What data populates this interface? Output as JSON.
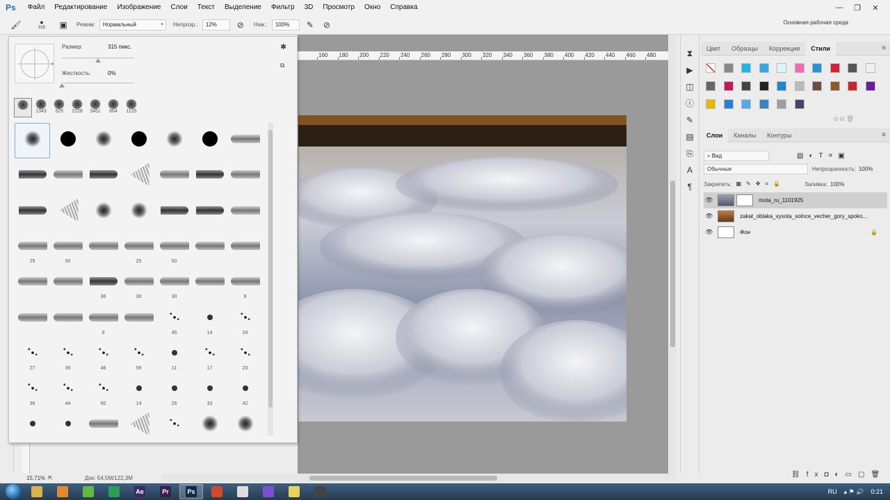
{
  "app": {
    "logo": "Ps"
  },
  "menu": [
    "Файл",
    "Редактирование",
    "Изображение",
    "Слои",
    "Текст",
    "Выделение",
    "Фильтр",
    "3D",
    "Просмотр",
    "Окно",
    "Справка"
  ],
  "window_controls": [
    "—",
    "❐",
    "✕"
  ],
  "options": {
    "brush_size_small": "315",
    "mode_label": "Режим:",
    "mode_value": "Нормальный",
    "opacity_label": "Непрозр.:",
    "opacity_value": "12%",
    "flow_label": "Наж.:",
    "flow_value": "100%",
    "workspace": "Основная рабочая среда"
  },
  "brush_panel": {
    "size_label": "Размер:",
    "size_value": "315 пикс.",
    "hardness_label": "Жесткость:",
    "hardness_value": "0%",
    "size_level": 0.5,
    "hardness_level": 0.0,
    "recent": [
      "",
      "1343",
      "329",
      "2228",
      "3461",
      "664",
      "1125"
    ],
    "brushes": [
      {
        "kind": "soft",
        "size": ""
      },
      {
        "kind": "hard",
        "size": ""
      },
      {
        "kind": "soft",
        "size": ""
      },
      {
        "kind": "hard",
        "size": ""
      },
      {
        "kind": "soft",
        "size": ""
      },
      {
        "kind": "hard",
        "size": ""
      },
      {
        "kind": "pencil",
        "size": ""
      },
      {
        "kind": "brushstroke",
        "size": ""
      },
      {
        "kind": "pencil",
        "size": ""
      },
      {
        "kind": "brushstroke",
        "size": ""
      },
      {
        "kind": "fan",
        "size": ""
      },
      {
        "kind": "pencil",
        "size": ""
      },
      {
        "kind": "brushstroke",
        "size": ""
      },
      {
        "kind": "pencil",
        "size": ""
      },
      {
        "kind": "brushstroke",
        "size": ""
      },
      {
        "kind": "fan",
        "size": ""
      },
      {
        "kind": "soft",
        "size": ""
      },
      {
        "kind": "soft",
        "size": ""
      },
      {
        "kind": "brushstroke",
        "size": ""
      },
      {
        "kind": "brushstroke",
        "size": ""
      },
      {
        "kind": "pencil",
        "size": ""
      },
      {
        "kind": "pencil",
        "size": "25"
      },
      {
        "kind": "pencil",
        "size": "50"
      },
      {
        "kind": "pencil",
        "size": ""
      },
      {
        "kind": "pencil",
        "size": "25"
      },
      {
        "kind": "pencil",
        "size": "50"
      },
      {
        "kind": "pencil",
        "size": ""
      },
      {
        "kind": "pencil",
        "size": ""
      },
      {
        "kind": "pencil",
        "size": ""
      },
      {
        "kind": "pencil",
        "size": ""
      },
      {
        "kind": "brushstroke",
        "size": "36"
      },
      {
        "kind": "pencil",
        "size": "30"
      },
      {
        "kind": "pencil",
        "size": "30"
      },
      {
        "kind": "pencil",
        "size": ""
      },
      {
        "kind": "pencil",
        "size": "9"
      },
      {
        "kind": "pencil",
        "size": ""
      },
      {
        "kind": "pencil",
        "size": ""
      },
      {
        "kind": "pencil",
        "size": "9"
      },
      {
        "kind": "pencil",
        "size": ""
      },
      {
        "kind": "spatter",
        "size": "45"
      },
      {
        "kind": "small-dot",
        "size": "14"
      },
      {
        "kind": "spatter",
        "size": "24"
      },
      {
        "kind": "spatter",
        "size": "27"
      },
      {
        "kind": "spatter",
        "size": "39"
      },
      {
        "kind": "spatter",
        "size": "46"
      },
      {
        "kind": "spatter",
        "size": "59"
      },
      {
        "kind": "small-dot",
        "size": "11"
      },
      {
        "kind": "spatter",
        "size": "17"
      },
      {
        "kind": "spatter",
        "size": "23"
      },
      {
        "kind": "spatter",
        "size": "36"
      },
      {
        "kind": "spatter",
        "size": "44"
      },
      {
        "kind": "spatter",
        "size": "60"
      },
      {
        "kind": "small-dot",
        "size": "14"
      },
      {
        "kind": "small-dot",
        "size": "26"
      },
      {
        "kind": "small-dot",
        "size": "33"
      },
      {
        "kind": "small-dot",
        "size": "42"
      },
      {
        "kind": "small-dot",
        "size": ""
      },
      {
        "kind": "small-dot",
        "size": ""
      },
      {
        "kind": "pencil",
        "size": ""
      },
      {
        "kind": "fan",
        "size": ""
      },
      {
        "kind": "spatter",
        "size": ""
      },
      {
        "kind": "soft",
        "size": ""
      },
      {
        "kind": "soft",
        "size": ""
      }
    ]
  },
  "ruler": [
    "160",
    "180",
    "200",
    "220",
    "240",
    "260",
    "280",
    "300",
    "320",
    "340",
    "360",
    "380",
    "400",
    "420",
    "440",
    "460",
    "480"
  ],
  "status": {
    "zoom": "15,71%",
    "doc": "Док: 54,5M/122,3M"
  },
  "panels": {
    "top_tabs": [
      "Цвет",
      "Образцы",
      "Коррекция",
      "Стили"
    ],
    "styles": [
      "#ffffff",
      "#888888",
      "#22b5e8",
      "#3aa6df",
      "#dff4fb",
      "#e96fb3",
      "#2c8fd9",
      "#d1233b",
      "#555555",
      "#f0f0f0",
      "#666666",
      "#c2185b",
      "#444444",
      "#222222",
      "#1e88c8",
      "#bbbbbb",
      "#6d4c41",
      "#8b5a2b",
      "#c62828",
      "#6a1b9a",
      "#e6b800",
      "#2c7fd0",
      "#57a7e0",
      "#3b82c4",
      "#9e9e9e",
      "#444466"
    ],
    "layer_tabs": [
      "Слои",
      "Каналы",
      "Контуры"
    ],
    "kind_label": "Вид",
    "blend_mode": "Обычные",
    "opacity_label": "Непрозрачность:",
    "opacity_value": "100%",
    "lock_label": "Закрепить:",
    "fill_label": "Заливка:",
    "fill_value": "100%",
    "layers": [
      {
        "name": "mota_ru_1101925",
        "selected": true
      },
      {
        "name": "zakat_oblaka_vysota_solnce_vecher_gory_spoko...",
        "selected": false
      },
      {
        "name": "Фон",
        "selected": false
      }
    ]
  },
  "taskbar": {
    "tasks": [
      "",
      "",
      "",
      "",
      "Ae",
      "Pr",
      "Ps",
      "",
      "",
      "",
      "",
      ""
    ],
    "lang": "RU",
    "time": "0:21"
  }
}
